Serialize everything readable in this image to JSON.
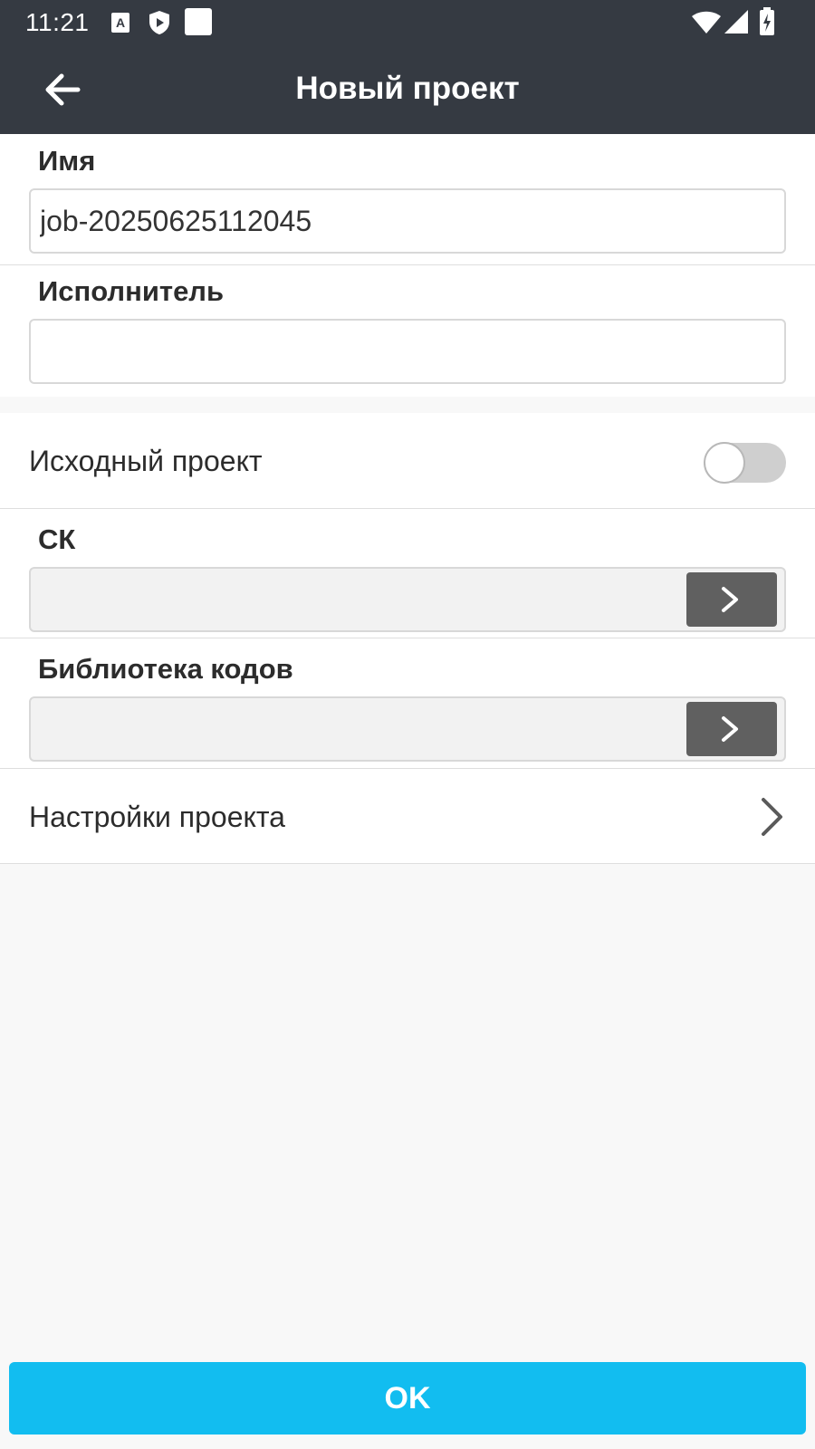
{
  "status_bar": {
    "time": "11:21",
    "icons": [
      "text-a-icon",
      "shield-play-icon",
      "white-square-icon",
      "wifi-icon",
      "signal-icon",
      "battery-charging-icon"
    ]
  },
  "app_bar": {
    "title": "Новый проект",
    "back_icon": "arrow-left-icon"
  },
  "form": {
    "name": {
      "label": "Имя",
      "value": "job-20250625112045"
    },
    "executor": {
      "label": "Исполнитель",
      "value": ""
    },
    "source_project": {
      "label": "Исходный проект",
      "enabled": false
    },
    "sk": {
      "label": "СК",
      "value": ""
    },
    "code_library": {
      "label": "Библиотека кодов",
      "value": ""
    },
    "project_settings": {
      "label": "Настройки проекта"
    }
  },
  "ok_button": {
    "label": "OK"
  },
  "colors": {
    "app_bar_bg": "#353a42",
    "ok_button_bg": "#12bdf0",
    "select_button_bg": "#606060",
    "page_bg": "#f8f8f8"
  }
}
